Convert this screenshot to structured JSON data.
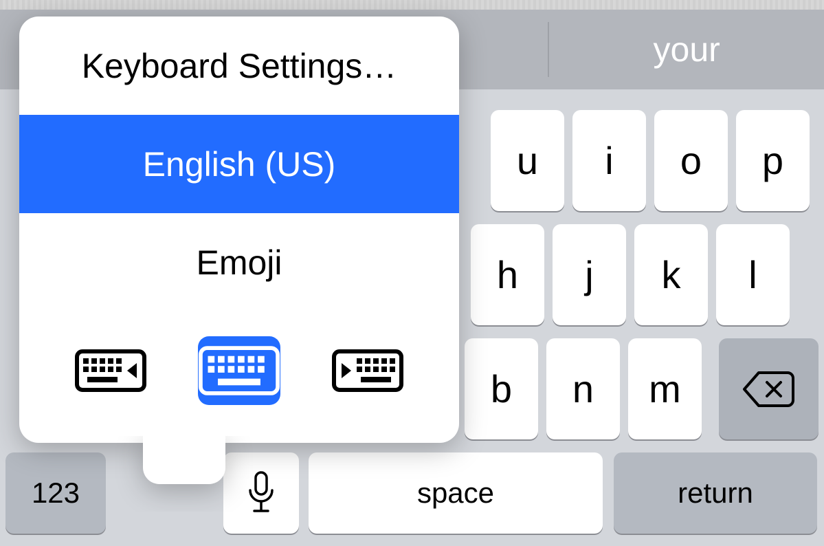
{
  "suggestions": [
    "",
    "",
    "your"
  ],
  "popover": {
    "settings_label": "Keyboard Settings…",
    "languages": [
      "English (US)",
      "Emoji"
    ],
    "selected_language_index": 0,
    "layout_selected_index": 1
  },
  "keys": {
    "row1": {
      "u": "u",
      "i": "i",
      "o": "o",
      "p": "p"
    },
    "row2": {
      "h": "h",
      "j": "j",
      "k": "k",
      "l": "l"
    },
    "row3": {
      "b": "b",
      "n": "n",
      "m": "m"
    },
    "numbers_label": "123",
    "space_label": "space",
    "return_label": "return"
  },
  "colors": {
    "selection_blue": "#226cff",
    "key_bg": "#ffffff",
    "func_key_bg": "#b4b9c1",
    "keyboard_bg": "#d3d6db"
  }
}
